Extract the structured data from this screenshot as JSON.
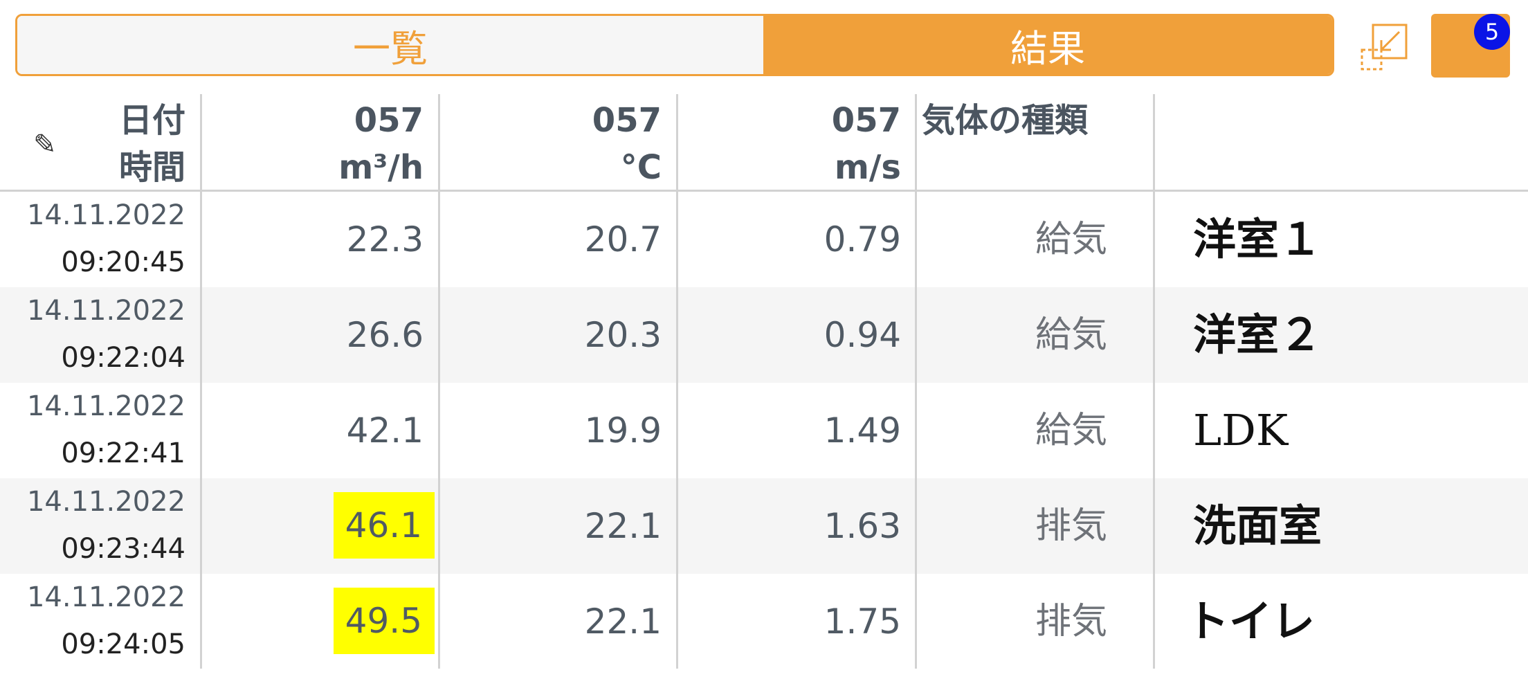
{
  "tabs": {
    "list_label": "一覧",
    "result_label": "結果"
  },
  "badge_count": "5",
  "colors": {
    "accent": "#f0a03a",
    "highlight": "#ffff00",
    "badge": "#0a14e6"
  },
  "header": {
    "date_col": [
      "日付",
      "時間"
    ],
    "flow": {
      "id": "057",
      "unit": "m³/h"
    },
    "temp": {
      "id": "057",
      "unit": "°C"
    },
    "speed": {
      "id": "057",
      "unit": "m/s"
    },
    "gas_type": "気体の種類",
    "edit_icon": "pencil-icon"
  },
  "rows": [
    {
      "date": "14.11.2022",
      "time": "09:20:45",
      "flow": "22.3",
      "temp": "20.7",
      "speed": "0.79",
      "gas": "給気",
      "room": "洋室１",
      "flow_highlight": false
    },
    {
      "date": "14.11.2022",
      "time": "09:22:04",
      "flow": "26.6",
      "temp": "20.3",
      "speed": "0.94",
      "gas": "給気",
      "room": "洋室２",
      "flow_highlight": false
    },
    {
      "date": "14.11.2022",
      "time": "09:22:41",
      "flow": "42.1",
      "temp": "19.9",
      "speed": "1.49",
      "gas": "給気",
      "room": "LDK",
      "flow_highlight": false
    },
    {
      "date": "14.11.2022",
      "time": "09:23:44",
      "flow": "46.1",
      "temp": "22.1",
      "speed": "1.63",
      "gas": "排気",
      "room": "洗面室",
      "flow_highlight": true
    },
    {
      "date": "14.11.2022",
      "time": "09:24:05",
      "flow": "49.5",
      "temp": "22.1",
      "speed": "1.75",
      "gas": "排気",
      "room": "トイレ",
      "flow_highlight": true
    }
  ]
}
